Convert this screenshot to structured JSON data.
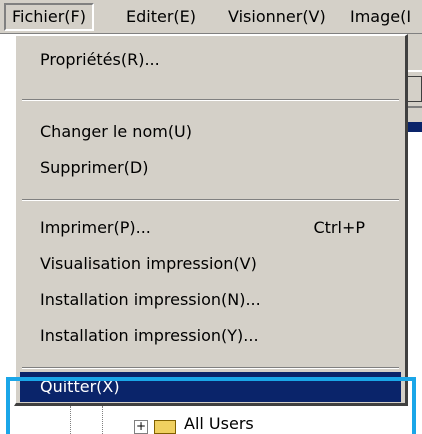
{
  "menubar": {
    "items": [
      {
        "label": "Fichier(F)"
      },
      {
        "label": "Editer(E)"
      },
      {
        "label": "Visionner(V)"
      },
      {
        "label": "Image(I"
      }
    ]
  },
  "menu": {
    "properties": {
      "label": "Propriétés(R)..."
    },
    "rename": {
      "label": "Changer le nom(U)"
    },
    "delete": {
      "label": "Supprimer(D)"
    },
    "print": {
      "label": "Imprimer(P)...",
      "shortcut": "Ctrl+P"
    },
    "print_preview": {
      "label": "Visualisation impression(V)"
    },
    "print_setup_n": {
      "label": "Installation impression(N)..."
    },
    "print_setup_y": {
      "label": "Installation impression(Y)..."
    },
    "quit": {
      "label": "Quitter(X)"
    }
  },
  "tree": {
    "expander": "+",
    "item_label": "All Users"
  },
  "colors": {
    "menu_bg": "#d4d0c8",
    "selection": "#0a246a",
    "highlight_frame": "#1aa6e8"
  }
}
